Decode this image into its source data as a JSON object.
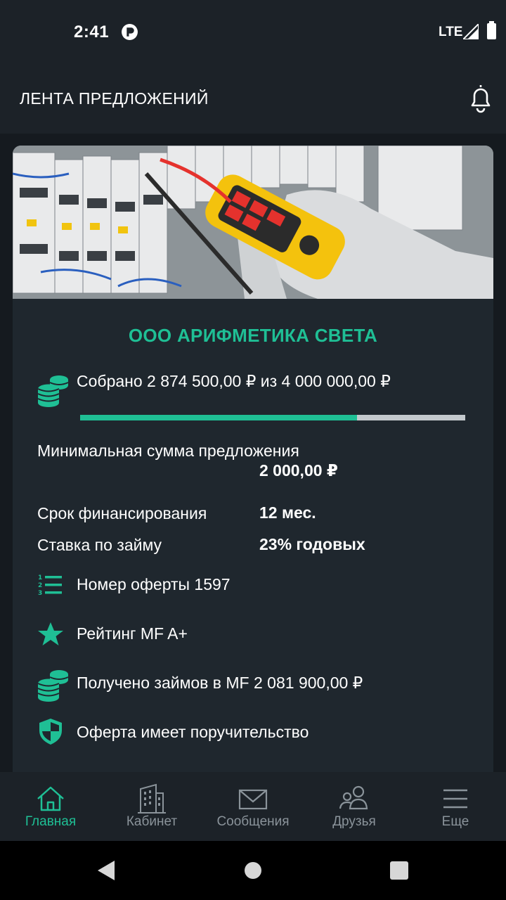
{
  "status_bar": {
    "time": "2:41",
    "network": "LTE"
  },
  "header": {
    "title": "ЛЕНТА ПРЕДЛОЖЕНИЙ"
  },
  "offer": {
    "company": "ООО АРИФМЕТИКА СВЕТА",
    "collected_text": "Собрано 2 874 500,00 ₽ из 4 000 000,00 ₽",
    "progress_fraction": 0.7186,
    "details": [
      {
        "label": "Минимальная сумма предложения",
        "value": "2 000,00 ₽"
      },
      {
        "label": "Срок финансирования",
        "value": "12 мес."
      },
      {
        "label": "Ставка по займу",
        "value": "23% годовых"
      }
    ],
    "info": {
      "offer_number": "Номер оферты 1597",
      "rating": "Рейтинг MF A+",
      "loans_received": "Получено займов в MF 2 081 900,00 ₽",
      "guarantee": "Оферта имеет поручительство"
    }
  },
  "tabs": [
    {
      "label": "Главная",
      "icon": "home-icon",
      "active": true
    },
    {
      "label": "Кабинет",
      "icon": "building-icon",
      "active": false
    },
    {
      "label": "Сообщения",
      "icon": "envelope-icon",
      "active": false
    },
    {
      "label": "Друзья",
      "icon": "friends-icon",
      "active": false
    },
    {
      "label": "Еще",
      "icon": "menu-icon",
      "active": false
    }
  ],
  "colors": {
    "accent": "#1fbf95",
    "background": "#1c2228",
    "card": "#1f272e",
    "track": "#c3c9cd"
  }
}
